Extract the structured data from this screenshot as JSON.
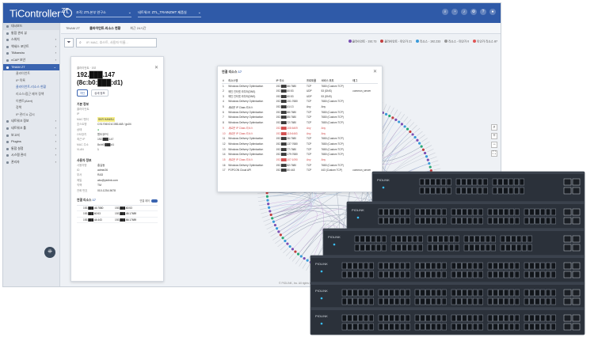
{
  "app": {
    "logo": "TiController",
    "logo_suffix": "ZT",
    "org_badge": "L",
    "site_selector": "조직: ZTL본부 연구소",
    "network_selector": "네트워크: ZTL_TRAINZWT 제품실",
    "top_icons": [
      "search-icon",
      "clock-icon",
      "bell-icon",
      "gear-icon",
      "help-icon",
      "user-icon"
    ]
  },
  "sidebar": {
    "items": [
      {
        "label": "대시보드",
        "type": "hdr",
        "chev": ""
      },
      {
        "label": "통합 관리 뷰",
        "type": "normal",
        "chev": ""
      },
      {
        "label": "스위치",
        "type": "normal",
        "chev": "›"
      },
      {
        "label": "액세스 포인트",
        "type": "normal",
        "chev": "›"
      },
      {
        "label": "TiMaestro",
        "type": "normal",
        "chev": "›"
      },
      {
        "label": "vCAP 보안",
        "type": "normal",
        "chev": "›"
      },
      {
        "label": "TiNAM ZT",
        "type": "active",
        "chev": "⌄"
      },
      {
        "label": "클라이언트",
        "type": "sub",
        "chev": ""
      },
      {
        "label": "IP 목록",
        "type": "sub",
        "chev": ""
      },
      {
        "label": "클라이언트-리소스 현황",
        "type": "sub sel2",
        "chev": ""
      },
      {
        "label": "리소스/접근 제어 정책",
        "type": "sub",
        "chev": ""
      },
      {
        "label": "이벤트(Alert)",
        "type": "sub",
        "chev": ""
      },
      {
        "label": "정책",
        "type": "sub",
        "chev": ""
      },
      {
        "label": "IP 관리 & 감시",
        "type": "sub",
        "chev": ""
      },
      {
        "label": "네트워크 정보",
        "type": "normal",
        "chev": "›"
      },
      {
        "label": "네트워크 툴",
        "type": "normal",
        "chev": "›"
      },
      {
        "label": "보고서",
        "type": "normal",
        "chev": "›"
      },
      {
        "label": "Plugins",
        "type": "normal",
        "chev": "›"
      },
      {
        "label": "통합 설정",
        "type": "normal",
        "chev": "›"
      },
      {
        "label": "시스템 관리",
        "type": "normal",
        "chev": "›"
      },
      {
        "label": "관리자",
        "type": "normal",
        "chev": "›"
      }
    ]
  },
  "tabs": [
    {
      "label": "TiNAM ZT",
      "active": false
    },
    {
      "label": "클라이언트-리소스 현황",
      "active": true
    },
    {
      "label": "최근 24시간",
      "active": false
    }
  ],
  "search": {
    "placeholder": "IP, MAC, 호스트, 사용자 이름..."
  },
  "legend": [
    {
      "label": "클라이언트 - 192.73",
      "color": "#7a4fb3"
    },
    {
      "label": "클라이언트 - 미인가 21",
      "color": "#c23f3f"
    },
    {
      "label": "리소스 - 192.233",
      "color": "#3a9ad9"
    },
    {
      "label": "리소스 - 미인가 0",
      "color": "#999999"
    },
    {
      "label": "미인가 리소스 87",
      "color": "#e05555"
    }
  ],
  "detail": {
    "meta": "클라이언트 · 192",
    "ip_title": "192.███.147 (8c:b0:███:d1)",
    "chips": [
      "차단",
      "상세 정보"
    ],
    "basic_title": "기본 정보",
    "basic": [
      {
        "k": "클라이언트",
        "v": "",
        "style": ""
      },
      {
        "k": "IP",
        "v": "",
        "style": ""
      },
      {
        "k": "MAC 벤더",
        "v": "SKR HANSU",
        "style": "hl"
      },
      {
        "k": "호스트명",
        "v": "CS1706X21C0B1448 / gs04",
        "style": ""
      },
      {
        "k": "상태",
        "v": "●",
        "style": "ok"
      },
      {
        "k": "OS/장치",
        "v": "윈도우PC",
        "style": ""
      },
      {
        "k": "최근 IP",
        "v": "192.███.147",
        "style": ""
      },
      {
        "k": "MAC 주소",
        "v": "8c:b0:███:d1",
        "style": ""
      },
      {
        "k": "VLAN",
        "v": "1",
        "style": ""
      }
    ],
    "user_title": "사용자 정보",
    "user": [
      {
        "k": "사용자명",
        "v": "홍길동"
      },
      {
        "k": "ID",
        "v": "admin26"
      },
      {
        "k": "부서",
        "v": "R&D"
      },
      {
        "k": "메일",
        "v": "abc@piolink.com"
      },
      {
        "k": "직책",
        "v": "TM"
      },
      {
        "k": "전화 번호",
        "v": "010-1234-5678"
      }
    ],
    "resource_title": "연결 리소스",
    "resource_count": "17",
    "toggle_label": "연결 제어",
    "resource_rows": [
      [
        "192.███.46:7880",
        "192.███.60:53"
      ],
      [
        "192.███.60:53",
        "192.███.45:17689"
      ],
      [
        "192.███.44:443",
        "192.███.66:17689"
      ]
    ]
  },
  "conn": {
    "title": "연결 리소스",
    "count": "17",
    "headers": [
      "#",
      "리소스명",
      "IP 주소",
      "프로토콜",
      "서비스 포트",
      "태그"
    ],
    "rows": [
      [
        "1",
        "Windows Delivery Optimization",
        "192.███.66:7680",
        "TCP",
        "7680 (Custom TCP)",
        "",
        false
      ],
      [
        "2",
        "메인 인터넷 라우터(DNS)",
        "192.███.60:53",
        "UDP",
        "53 (DNS)",
        "common_server",
        false
      ],
      [
        "3",
        "메인 인터넷 라우터(DNS)",
        "192.███.60:53",
        "UDP",
        "53 (DNS)",
        "",
        false
      ],
      [
        "4",
        "Windows Delivery Optimization",
        "192.███.151:7680",
        "TCP",
        "7680 (Custom TCP)",
        "",
        false
      ],
      [
        "5",
        "새로운 IP Class 리소스",
        "192.███.41:13",
        "Any",
        "Any",
        "",
        false
      ],
      [
        "6",
        "Windows Delivery Optimization",
        "192.███.88:7680",
        "TCP",
        "7680 (Custom TCP)",
        "",
        false
      ],
      [
        "7",
        "Windows Delivery Optimization",
        "192.███.85:7680",
        "TCP",
        "7680 (Custom TCP)",
        "",
        false
      ],
      [
        "8",
        "Windows Delivery Optimization",
        "192.███.72:7680",
        "TCP",
        "7680 (Custom TCP)",
        "",
        false
      ],
      [
        "9",
        "새로운 IP Class 리소스",
        "192.███.108:6409",
        "Any",
        "Any",
        "",
        true
      ],
      [
        "10",
        "새로운 IP Class 리소스",
        "192.███.115:6463",
        "Any",
        "Any",
        "",
        true
      ],
      [
        "11",
        "Windows Delivery Optimization",
        "192.███.36:7680",
        "TCP",
        "7680 (Custom TCP)",
        "",
        false
      ],
      [
        "12",
        "Windows Delivery Optimization",
        "192.███.137:7680",
        "TCP",
        "7680 (Custom TCP)",
        "",
        false
      ],
      [
        "13",
        "Windows Delivery Optimization",
        "192.███.77:7680",
        "TCP",
        "7680 (Custom TCP)",
        "",
        false
      ],
      [
        "14",
        "Windows Delivery Optimization",
        "192.███.179:7680",
        "TCP",
        "7680 (Custom TCP)",
        "",
        false
      ],
      [
        "15",
        "새로운 IP Class 리소스",
        "192.███.107:1090",
        "Any",
        "Any",
        "",
        true
      ],
      [
        "16",
        "Windows Delivery Optimization",
        "192.███.82:7680",
        "TCP",
        "7680 (Custom TCP)",
        "",
        false
      ],
      [
        "17",
        "POPCON Cloud API",
        "192.███.80:443",
        "TCP",
        "443 (Custom TCP)",
        "common_server",
        false
      ]
    ]
  },
  "zoom": [
    "⌕",
    "+",
    "−",
    "⛶"
  ],
  "footer": "© PIOLINK, Inc. All rights reserved.",
  "switch_brand": "PIOLINK"
}
